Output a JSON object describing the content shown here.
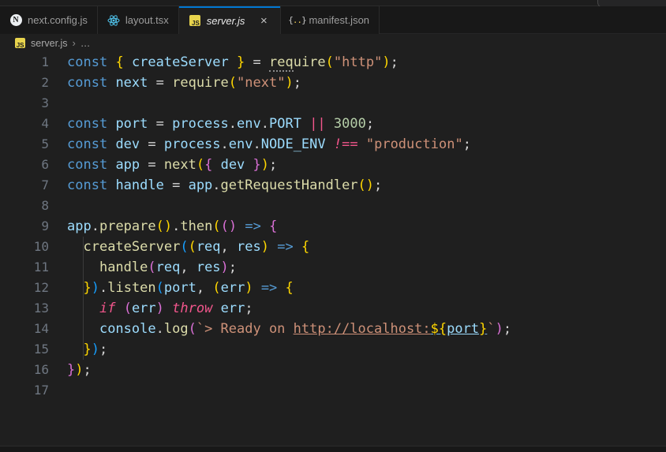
{
  "colors": {
    "editor_bg": "#1f1f1f",
    "tabbar_bg": "#181818",
    "active_tab_accent": "#0078d4",
    "keyword": "#569cd6",
    "variable": "#9cdcfe",
    "function": "#dcdcaa",
    "string": "#ce9178",
    "number": "#b5cea8",
    "control_pink": "#f2568c",
    "bracket_gold": "#ffd700",
    "bracket_orchid": "#da70d6",
    "bracket_blue": "#179fff",
    "line_number": "#6e7681"
  },
  "tabs": [
    {
      "label": "next.config.js",
      "icon": "nextjs-icon",
      "active": false
    },
    {
      "label": "layout.tsx",
      "icon": "react-icon",
      "active": false
    },
    {
      "label": "server.js",
      "icon": "js-icon",
      "active": true,
      "close_glyph": "×"
    },
    {
      "label": "manifest.json",
      "icon": "json-icon",
      "active": false
    }
  ],
  "tab_icons": {
    "next_letter": "N",
    "js_letters": "JS",
    "json_open": "{",
    "json_dots": "..",
    "json_close": "}"
  },
  "breadcrumb": {
    "file": "server.js",
    "separator": "›",
    "rest": "…"
  },
  "editor": {
    "indent_guides": [
      {
        "from_line": 10,
        "to_line": 15,
        "col": 2
      }
    ],
    "lines": [
      {
        "n": "1",
        "t": [
          [
            "kw",
            "const"
          ],
          [
            "pl",
            " "
          ],
          [
            "b1",
            "{"
          ],
          [
            "pl",
            " "
          ],
          [
            "vr",
            "createServer"
          ],
          [
            "pl",
            " "
          ],
          [
            "b1",
            "}"
          ],
          [
            "pl",
            " = "
          ],
          [
            "fnh",
            "req"
          ],
          [
            "fn",
            "uire"
          ],
          [
            "b1",
            "("
          ],
          [
            "st",
            "\"http\""
          ],
          [
            "b1",
            ")"
          ],
          [
            "pl",
            ";"
          ]
        ]
      },
      {
        "n": "2",
        "t": [
          [
            "kw",
            "const"
          ],
          [
            "pl",
            " "
          ],
          [
            "vr",
            "next"
          ],
          [
            "pl",
            " = "
          ],
          [
            "fn",
            "require"
          ],
          [
            "b1",
            "("
          ],
          [
            "st",
            "\"next\""
          ],
          [
            "b1",
            ")"
          ],
          [
            "pl",
            ";"
          ]
        ]
      },
      {
        "n": "3",
        "t": []
      },
      {
        "n": "4",
        "t": [
          [
            "kw",
            "const"
          ],
          [
            "pl",
            " "
          ],
          [
            "vr",
            "port"
          ],
          [
            "pl",
            " = "
          ],
          [
            "vr",
            "process"
          ],
          [
            "pl",
            "."
          ],
          [
            "vr",
            "env"
          ],
          [
            "pl",
            "."
          ],
          [
            "vr",
            "PORT"
          ],
          [
            "pl",
            " "
          ],
          [
            "ct",
            "||"
          ],
          [
            "pl",
            " "
          ],
          [
            "nm",
            "3000"
          ],
          [
            "pl",
            ";"
          ]
        ]
      },
      {
        "n": "5",
        "t": [
          [
            "kw",
            "const"
          ],
          [
            "pl",
            " "
          ],
          [
            "vr",
            "dev"
          ],
          [
            "pl",
            " = "
          ],
          [
            "vr",
            "process"
          ],
          [
            "pl",
            "."
          ],
          [
            "vr",
            "env"
          ],
          [
            "pl",
            "."
          ],
          [
            "vr",
            "NODE_ENV"
          ],
          [
            "pl",
            " "
          ],
          [
            "ct",
            "!=="
          ],
          [
            "pl",
            " "
          ],
          [
            "st",
            "\"production\""
          ],
          [
            "pl",
            ";"
          ]
        ]
      },
      {
        "n": "6",
        "t": [
          [
            "kw",
            "const"
          ],
          [
            "pl",
            " "
          ],
          [
            "vr",
            "app"
          ],
          [
            "pl",
            " = "
          ],
          [
            "fn",
            "next"
          ],
          [
            "b1",
            "("
          ],
          [
            "b2",
            "{"
          ],
          [
            "pl",
            " "
          ],
          [
            "vr",
            "dev"
          ],
          [
            "pl",
            " "
          ],
          [
            "b2",
            "}"
          ],
          [
            "b1",
            ")"
          ],
          [
            "pl",
            ";"
          ]
        ]
      },
      {
        "n": "7",
        "t": [
          [
            "kw",
            "const"
          ],
          [
            "pl",
            " "
          ],
          [
            "vr",
            "handle"
          ],
          [
            "pl",
            " = "
          ],
          [
            "vr",
            "app"
          ],
          [
            "pl",
            "."
          ],
          [
            "fn",
            "getRequestHandler"
          ],
          [
            "b1",
            "("
          ],
          [
            "b1",
            ")"
          ],
          [
            "pl",
            ";"
          ]
        ]
      },
      {
        "n": "8",
        "t": []
      },
      {
        "n": "9",
        "t": [
          [
            "vr",
            "app"
          ],
          [
            "pl",
            "."
          ],
          [
            "fn",
            "prepare"
          ],
          [
            "b1",
            "("
          ],
          [
            "b1",
            ")"
          ],
          [
            "pl",
            "."
          ],
          [
            "fn",
            "then"
          ],
          [
            "b1",
            "("
          ],
          [
            "b2",
            "("
          ],
          [
            "b2",
            ")"
          ],
          [
            "pl",
            " "
          ],
          [
            "kw",
            "=>"
          ],
          [
            "pl",
            " "
          ],
          [
            "b2",
            "{"
          ]
        ]
      },
      {
        "n": "10",
        "t": [
          [
            "pl",
            "  "
          ],
          [
            "fn",
            "createServer"
          ],
          [
            "b3",
            "("
          ],
          [
            "b1",
            "("
          ],
          [
            "vr",
            "req"
          ],
          [
            "pl",
            ", "
          ],
          [
            "vr",
            "res"
          ],
          [
            "b1",
            ")"
          ],
          [
            "pl",
            " "
          ],
          [
            "kw",
            "=>"
          ],
          [
            "pl",
            " "
          ],
          [
            "b1",
            "{"
          ]
        ]
      },
      {
        "n": "11",
        "t": [
          [
            "pl",
            "    "
          ],
          [
            "fn",
            "handle"
          ],
          [
            "b2",
            "("
          ],
          [
            "vr",
            "req"
          ],
          [
            "pl",
            ", "
          ],
          [
            "vr",
            "res"
          ],
          [
            "b2",
            ")"
          ],
          [
            "pl",
            ";"
          ]
        ]
      },
      {
        "n": "12",
        "t": [
          [
            "pl",
            "  "
          ],
          [
            "b1",
            "}"
          ],
          [
            "b3",
            ")"
          ],
          [
            "pl",
            "."
          ],
          [
            "fn",
            "listen"
          ],
          [
            "b3",
            "("
          ],
          [
            "vr",
            "port"
          ],
          [
            "pl",
            ", "
          ],
          [
            "b1",
            "("
          ],
          [
            "vr",
            "err"
          ],
          [
            "b1",
            ")"
          ],
          [
            "pl",
            " "
          ],
          [
            "kw",
            "=>"
          ],
          [
            "pl",
            " "
          ],
          [
            "b1",
            "{"
          ]
        ]
      },
      {
        "n": "13",
        "t": [
          [
            "pl",
            "    "
          ],
          [
            "ct",
            "if"
          ],
          [
            "pl",
            " "
          ],
          [
            "b2",
            "("
          ],
          [
            "vr",
            "err"
          ],
          [
            "b2",
            ")"
          ],
          [
            "pl",
            " "
          ],
          [
            "ct",
            "throw"
          ],
          [
            "pl",
            " "
          ],
          [
            "vr",
            "err"
          ],
          [
            "pl",
            ";"
          ]
        ]
      },
      {
        "n": "14",
        "t": [
          [
            "pl",
            "    "
          ],
          [
            "vr",
            "console"
          ],
          [
            "pl",
            "."
          ],
          [
            "fn",
            "log"
          ],
          [
            "b2",
            "("
          ],
          [
            "st",
            "`> Ready on "
          ],
          [
            "lk",
            "http://localhost:"
          ],
          [
            "lkb",
            "${"
          ],
          [
            "lkv",
            "port"
          ],
          [
            "lkb",
            "}"
          ],
          [
            "st",
            "`"
          ],
          [
            "b2",
            ")"
          ],
          [
            "pl",
            ";"
          ]
        ]
      },
      {
        "n": "15",
        "t": [
          [
            "pl",
            "  "
          ],
          [
            "b1",
            "}"
          ],
          [
            "b3",
            ")"
          ],
          [
            "pl",
            ";"
          ]
        ]
      },
      {
        "n": "16",
        "t": [
          [
            "b2",
            "}"
          ],
          [
            "b1",
            ")"
          ],
          [
            "pl",
            ";"
          ]
        ]
      },
      {
        "n": "17",
        "t": []
      }
    ]
  }
}
